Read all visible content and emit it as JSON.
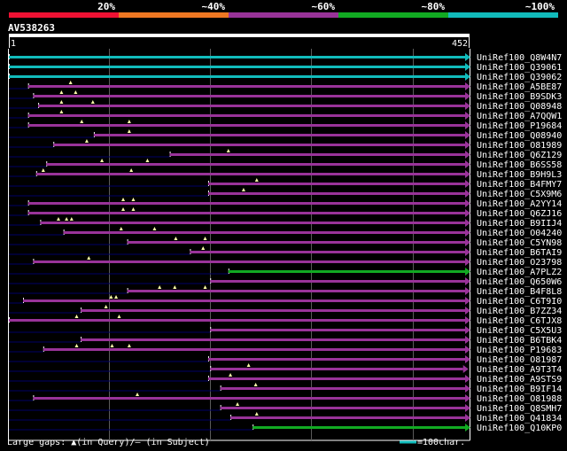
{
  "chart_data": {
    "type": "alignment-overview",
    "query_id": "AV538263",
    "query_range": [
      1,
      452
    ],
    "scale_labels": [
      "20%",
      "~40%",
      "~60%",
      "~80%",
      "~100%"
    ],
    "colors": {
      "identity_bins": [
        "#ee1133",
        "#ee7722",
        "#993399",
        "#11aa22",
        "#11bbbb"
      ],
      "query_bar": "#ffffff",
      "gap_marker": "#ffffaa",
      "frame": "#ffffff",
      "grid": "#5a5a5a",
      "dark_line": "#000066"
    },
    "hits": [
      {
        "name": "UniRef100_Q8W4N7",
        "start": 1,
        "end": 452,
        "color": "#11bbbb",
        "gaps": []
      },
      {
        "name": "UniRef100_Q39061",
        "start": 1,
        "end": 452,
        "color": "#11bbbb",
        "gaps": []
      },
      {
        "name": "UniRef100_Q39062",
        "start": 1,
        "end": 452,
        "color": "#11bbbb",
        "gaps": []
      },
      {
        "name": "UniRef100_A5BE87",
        "start": 20,
        "end": 452,
        "color": "#993399",
        "gaps": [
          62
        ]
      },
      {
        "name": "UniRef100_B9SDK3",
        "start": 25,
        "end": 452,
        "color": "#993399",
        "gaps": [
          53,
          67
        ]
      },
      {
        "name": "UniRef100_Q08948",
        "start": 30,
        "end": 452,
        "color": "#993399",
        "gaps": [
          53,
          84
        ]
      },
      {
        "name": "UniRef100_A7QQW1",
        "start": 20,
        "end": 452,
        "color": "#993399",
        "gaps": [
          53
        ]
      },
      {
        "name": "UniRef100_P19684",
        "start": 20,
        "end": 452,
        "color": "#993399",
        "gaps": [
          73,
          120
        ]
      },
      {
        "name": "UniRef100_Q08940",
        "start": 85,
        "end": 452,
        "color": "#993399",
        "gaps": [
          120
        ]
      },
      {
        "name": "UniRef100_O81989",
        "start": 45,
        "end": 452,
        "color": "#993399",
        "gaps": [
          78
        ]
      },
      {
        "name": "UniRef100_Q6Z129",
        "start": 160,
        "end": 452,
        "color": "#993399",
        "gaps": [
          218
        ]
      },
      {
        "name": "UniRef100_B6SS58",
        "start": 38,
        "end": 452,
        "color": "#993399",
        "gaps": [
          93,
          138
        ]
      },
      {
        "name": "UniRef100_B9H9L3",
        "start": 28,
        "end": 452,
        "color": "#993399",
        "gaps": [
          35,
          122
        ]
      },
      {
        "name": "UniRef100_B4FMY7",
        "start": 198,
        "end": 452,
        "color": "#993399",
        "gaps": [
          246
        ]
      },
      {
        "name": "UniRef100_C5X9M6",
        "start": 198,
        "end": 452,
        "color": "#993399",
        "gaps": [
          233
        ]
      },
      {
        "name": "UniRef100_A2YY14",
        "start": 20,
        "end": 452,
        "color": "#993399",
        "gaps": [
          114,
          124
        ]
      },
      {
        "name": "UniRef100_Q6ZJ16",
        "start": 20,
        "end": 452,
        "color": "#993399",
        "gaps": [
          114,
          124
        ]
      },
      {
        "name": "UniRef100_B9IIJ4",
        "start": 32,
        "end": 452,
        "color": "#993399",
        "gaps": [
          50,
          58,
          63
        ]
      },
      {
        "name": "UniRef100_O04240",
        "start": 55,
        "end": 452,
        "color": "#993399",
        "gaps": [
          112,
          145
        ]
      },
      {
        "name": "UniRef100_C5YN98",
        "start": 118,
        "end": 452,
        "color": "#993399",
        "gaps": [
          166,
          195
        ]
      },
      {
        "name": "UniRef100_B6TAI9",
        "start": 180,
        "end": 452,
        "color": "#993399",
        "gaps": [
          193
        ]
      },
      {
        "name": "UniRef100_O23798",
        "start": 25,
        "end": 452,
        "color": "#993399",
        "gaps": [
          80
        ]
      },
      {
        "name": "UniRef100_A7PLZ2",
        "start": 218,
        "end": 452,
        "color": "#11aa22",
        "gaps": []
      },
      {
        "name": "UniRef100_Q650W6",
        "start": 200,
        "end": 452,
        "color": "#993399",
        "gaps": []
      },
      {
        "name": "UniRef100_B4F8L8",
        "start": 118,
        "end": 452,
        "color": "#993399",
        "gaps": [
          150,
          165,
          195
        ]
      },
      {
        "name": "UniRef100_C6T9I0",
        "start": 15,
        "end": 452,
        "color": "#993399",
        "gaps": [
          102,
          107
        ]
      },
      {
        "name": "UniRef100_B7ZZ34",
        "start": 72,
        "end": 452,
        "color": "#993399",
        "gaps": [
          97
        ]
      },
      {
        "name": "UniRef100_C6TJX8",
        "start": 1,
        "end": 452,
        "color": "#993399",
        "gaps": [
          68,
          110
        ]
      },
      {
        "name": "UniRef100_C5X5U3",
        "start": 200,
        "end": 452,
        "color": "#993399",
        "gaps": []
      },
      {
        "name": "UniRef100_B6TBK4",
        "start": 72,
        "end": 452,
        "color": "#993399",
        "gaps": []
      },
      {
        "name": "UniRef100_P19683",
        "start": 35,
        "end": 452,
        "color": "#993399",
        "gaps": [
          68,
          103,
          120
        ]
      },
      {
        "name": "UniRef100_O81987",
        "start": 198,
        "end": 452,
        "color": "#993399",
        "gaps": []
      },
      {
        "name": "UniRef100_A9T3T4",
        "start": 200,
        "end": 450,
        "color": "#993399",
        "gaps": [
          238
        ]
      },
      {
        "name": "UniRef100_A9STS9",
        "start": 198,
        "end": 452,
        "color": "#993399",
        "gaps": [
          220
        ]
      },
      {
        "name": "UniRef100_B9IF14",
        "start": 210,
        "end": 452,
        "color": "#993399",
        "gaps": [
          245
        ]
      },
      {
        "name": "UniRef100_O81988",
        "start": 25,
        "end": 452,
        "color": "#993399",
        "gaps": [
          128
        ]
      },
      {
        "name": "UniRef100_Q8SMH7",
        "start": 210,
        "end": 452,
        "color": "#993399",
        "gaps": [
          227
        ]
      },
      {
        "name": "UniRef100_Q41834",
        "start": 220,
        "end": 452,
        "color": "#993399",
        "gaps": [
          246
        ]
      },
      {
        "name": "UniRef100_Q10KP0",
        "start": 242,
        "end": 452,
        "color": "#11aa22",
        "gaps": []
      }
    ],
    "footer": {
      "gap_legend": "Large gaps: ▲(in Query)/– (in Subject)",
      "scale_note": "=100char."
    }
  }
}
